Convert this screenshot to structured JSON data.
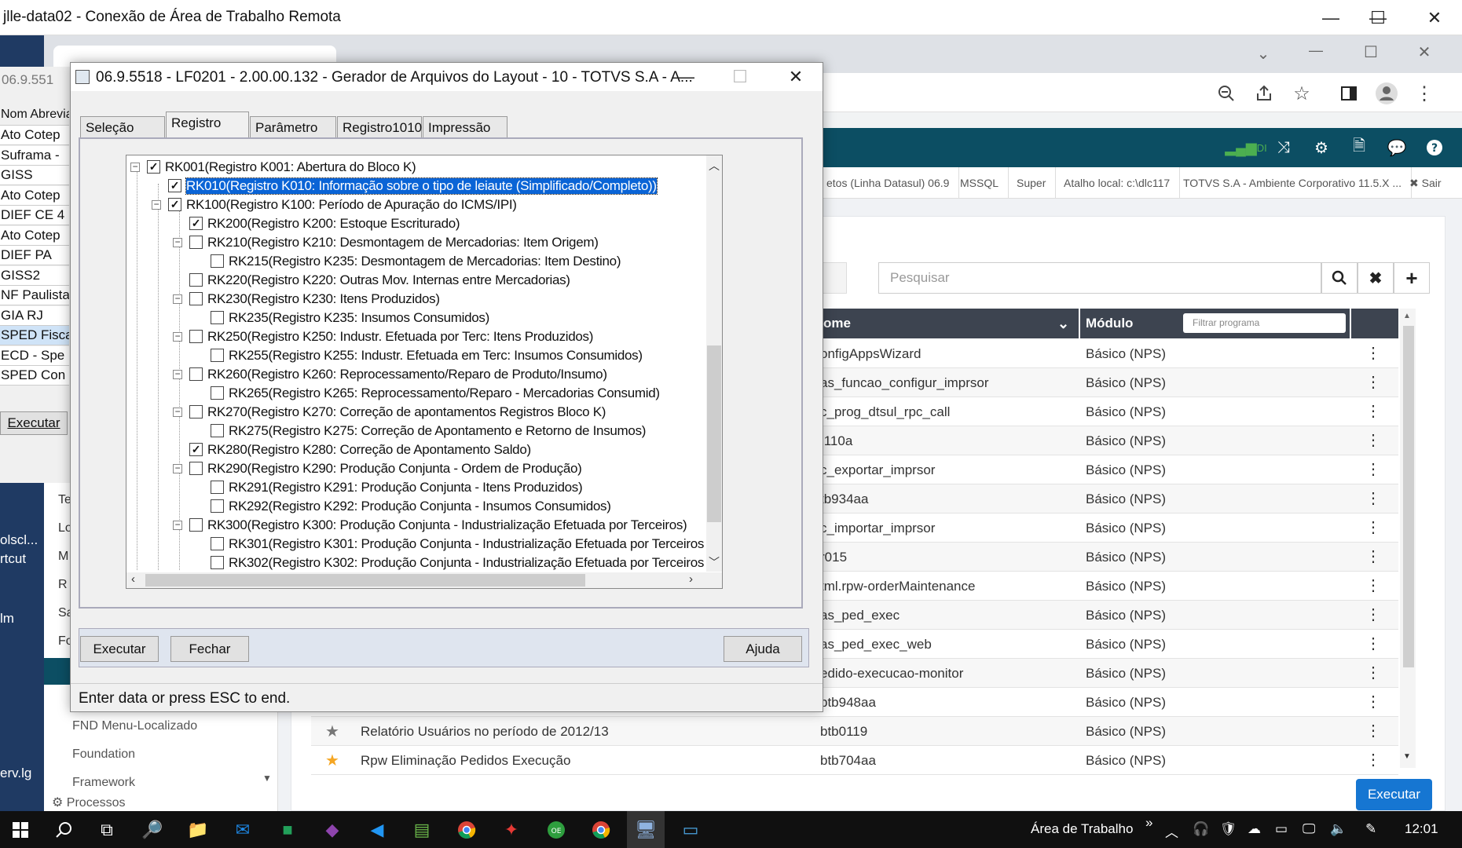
{
  "rdp": {
    "title": "jlle-data02 - Conexão de Área de Trabalho Remota",
    "minimize": "—",
    "maximize": "☐",
    "close": "✕"
  },
  "browser": {
    "icons": {
      "zoom": "zoom-out-icon",
      "share": "share-icon",
      "star": "star-icon",
      "sidepanel": "side-panel-icon",
      "profile": "profile-icon",
      "menu": "menu-icon"
    },
    "win_min": "—",
    "win_max": "☐",
    "win_close": "✕",
    "chevron": "⌄"
  },
  "appbar": {
    "signal_label": "DI",
    "icons": [
      "signal-icon",
      "shuffle-icon",
      "gear-icon",
      "document-icon",
      "chat-icon",
      "help-icon"
    ]
  },
  "infobar": {
    "env": "etos (Linha Datasul) 06.9",
    "db": "MSSQL",
    "user": "Super",
    "shortcut": "Atalho local: c:\\dlc117",
    "company": "TOTVS S.A - Ambiente Corporativo 11.5.X ...",
    "exit": "✖ Sair"
  },
  "program_list": {
    "search_placeholder": "Pesquisar",
    "col_name": "ome",
    "col_module": "Módulo",
    "filter_placeholder": "Filtrar programa",
    "rows": [
      {
        "title": "",
        "name": "onfigAppsWizard",
        "module": "Básico (NPS)",
        "fav": false
      },
      {
        "title": "",
        "name": "as_funcao_configur_imprsor",
        "module": "Básico (NPS)",
        "fav": false
      },
      {
        "title": "",
        "name": "c_prog_dtsul_rpc_call",
        "module": "Básico (NPS)",
        "fav": false
      },
      {
        "title": "",
        "name": ":110a",
        "module": "Básico (NPS)",
        "fav": false
      },
      {
        "title": "",
        "name": "c_exportar_imprsor",
        "module": "Básico (NPS)",
        "fav": false
      },
      {
        "title": "",
        "name": "tb934aa",
        "module": "Básico (NPS)",
        "fav": false
      },
      {
        "title": "",
        "name": "c_importar_imprsor",
        "module": "Básico (NPS)",
        "fav": false
      },
      {
        "title": "",
        "name": "r015",
        "module": "Básico (NPS)",
        "fav": false
      },
      {
        "title": "",
        "name": "tml.rpw-orderMaintenance",
        "module": "Básico (NPS)",
        "fav": false
      },
      {
        "title": "",
        "name": "as_ped_exec",
        "module": "Básico (NPS)",
        "fav": false
      },
      {
        "title": "",
        "name": "as_ped_exec_web",
        "module": "Básico (NPS)",
        "fav": false
      },
      {
        "title": "",
        "name": "edido-execucao-monitor",
        "module": "Básico (NPS)",
        "fav": false
      },
      {
        "title": "",
        "name": "btb948aa",
        "module": "Básico (NPS)",
        "fav": false
      },
      {
        "title": "Relatório Usuários no período de 2012/13",
        "name": "btb0119",
        "module": "Básico (NPS)",
        "fav": false
      },
      {
        "title": "Rpw Eliminação Pedidos Execução",
        "name": "btb704aa",
        "module": "Básico (NPS)",
        "fav": true
      }
    ],
    "execute": "Executar"
  },
  "sidenav": {
    "items": [
      "Te",
      "Lo",
      "M",
      "R",
      "Sa",
      "Fo"
    ],
    "bottom_items": [
      "FND Menu-Localizado",
      "Foundation",
      "Framework"
    ],
    "processes": "⚙ Processos"
  },
  "bg_window": {
    "title": "06.9.551",
    "header": "Nom Abrevia",
    "items": [
      "Ato Cotep",
      "Suframa -",
      "GISS",
      "Ato Cotep",
      "DIEF CE 4",
      "Ato Cotep",
      "DIEF PA",
      "GISS2",
      "NF Paulista",
      "GIA RJ",
      "SPED Fisca",
      "ECD - Spe",
      "SPED Con"
    ],
    "execute": "Executar"
  },
  "desktop_labels": [
    "olscl...",
    "rtcut",
    "lm",
    "erv.lg"
  ],
  "dialog": {
    "title": "06.9.5518 - LF0201 - 2.00.00.132 - Gerador de Arquivos do Layout - 10 - TOTVS S.A - A...",
    "tabs": [
      "Seleção",
      "Registro",
      "Parâmetro",
      "Registro1010",
      "Impressão"
    ],
    "tree": [
      {
        "label": "RK001(Registro K001: Abertura do Bloco K)",
        "level": 0,
        "checked": true,
        "toggle": "−",
        "selected": false
      },
      {
        "label": "RK010(Registro K010: Informação sobre o tipo de leiaute (Simplificado/Completo))",
        "level": 1,
        "checked": true,
        "toggle": "",
        "selected": true
      },
      {
        "label": "RK100(Registro K100: Período de Apuração do ICMS/IPI)",
        "level": 1,
        "checked": true,
        "toggle": "−",
        "selected": false
      },
      {
        "label": "RK200(Registro K200: Estoque Escriturado)",
        "level": 2,
        "checked": true,
        "toggle": "",
        "selected": false
      },
      {
        "label": "RK210(Registro K210: Desmontagem de Mercadorias: Item Origem)",
        "level": 2,
        "checked": false,
        "toggle": "−",
        "selected": false
      },
      {
        "label": "RK215(Registro K235: Desmontagem de Mercadorias: Item Destino)",
        "level": 3,
        "checked": false,
        "toggle": "",
        "selected": false
      },
      {
        "label": "RK220(Registro K220: Outras Mov. Internas entre Mercadorias)",
        "level": 2,
        "checked": false,
        "toggle": "",
        "selected": false
      },
      {
        "label": "RK230(Registro K230: Itens Produzidos)",
        "level": 2,
        "checked": false,
        "toggle": "−",
        "selected": false
      },
      {
        "label": "RK235(Registro K235: Insumos Consumidos)",
        "level": 3,
        "checked": false,
        "toggle": "",
        "selected": false
      },
      {
        "label": "RK250(Registro K250: Industr. Efetuada por Terc: Itens Produzidos)",
        "level": 2,
        "checked": false,
        "toggle": "−",
        "selected": false
      },
      {
        "label": "RK255(Registro K255: Industr. Efetuada em Terc: Insumos Consumidos)",
        "level": 3,
        "checked": false,
        "toggle": "",
        "selected": false
      },
      {
        "label": "RK260(Registro K260: Reprocessamento/Reparo de Produto/Insumo)",
        "level": 2,
        "checked": false,
        "toggle": "−",
        "selected": false
      },
      {
        "label": "RK265(Registro K265: Reprocessamento/Reparo - Mercadorias Consumid)",
        "level": 3,
        "checked": false,
        "toggle": "",
        "selected": false
      },
      {
        "label": "RK270(Registro K270: Correção de apontamentos Registros Bloco K)",
        "level": 2,
        "checked": false,
        "toggle": "−",
        "selected": false
      },
      {
        "label": "RK275(Registro K275: Correção de Apontamento e Retorno de Insumos)",
        "level": 3,
        "checked": false,
        "toggle": "",
        "selected": false
      },
      {
        "label": "RK280(Registro K280: Correção de Apontamento Saldo)",
        "level": 2,
        "checked": true,
        "toggle": "",
        "selected": false
      },
      {
        "label": "RK290(Registro K290: Produção Conjunta - Ordem de Produção)",
        "level": 2,
        "checked": false,
        "toggle": "−",
        "selected": false
      },
      {
        "label": "RK291(Registro K291: Produção Conjunta - Itens Produzidos)",
        "level": 3,
        "checked": false,
        "toggle": "",
        "selected": false
      },
      {
        "label": "RK292(Registro K292: Produção Conjunta - Insumos Consumidos)",
        "level": 3,
        "checked": false,
        "toggle": "",
        "selected": false
      },
      {
        "label": "RK300(Registro K300: Produção Conjunta - Industrialização Efetuada por Terceiros)",
        "level": 2,
        "checked": false,
        "toggle": "−",
        "selected": false
      },
      {
        "label": "RK301(Registro K301: Produção Conjunta - Industrialização Efetuada por Terceiros",
        "level": 3,
        "checked": false,
        "toggle": "",
        "selected": false
      },
      {
        "label": "RK302(Registro K302: Produção Conjunta - Industrialização Efetuada por Terceiros",
        "level": 3,
        "checked": false,
        "toggle": "",
        "selected": false
      }
    ],
    "btn_execute": "Executar",
    "btn_close": "Fechar",
    "btn_help": "Ajuda",
    "status": "Enter data or press ESC to end."
  },
  "taskbar": {
    "desktop_label": "Área de Trabalho",
    "chevron": "»",
    "time": "12:01"
  }
}
